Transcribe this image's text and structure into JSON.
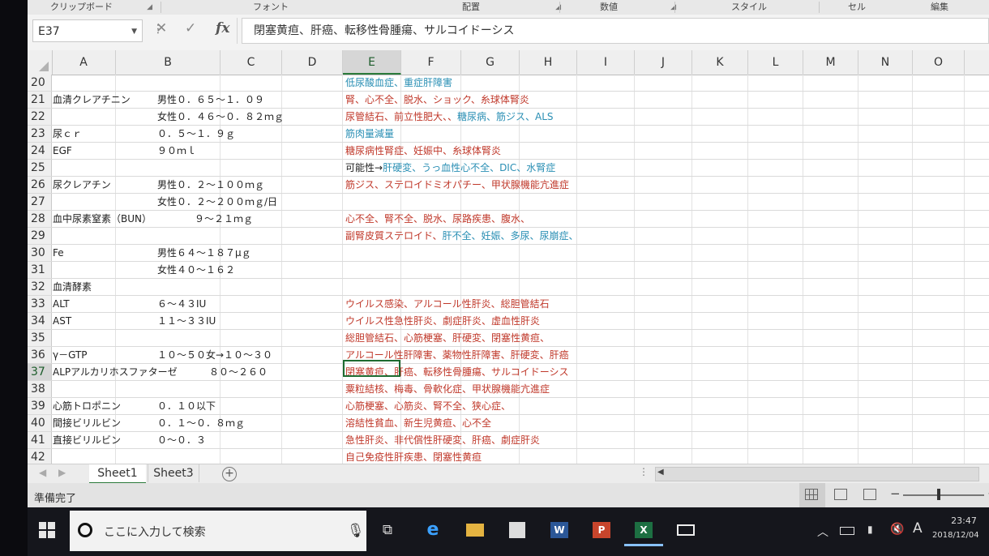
{
  "ribbon": {
    "groups": [
      "クリップボード",
      "フォント",
      "配置",
      "数値",
      "スタイル",
      "セル",
      "編集"
    ]
  },
  "formula_bar": {
    "name_box": "E37",
    "formula": "閉塞黄疸、肝癌、転移性骨腫瘍、サルコイドーシス"
  },
  "columns": [
    "A",
    "B",
    "C",
    "D",
    "E",
    "F",
    "G",
    "H",
    "I",
    "J",
    "K",
    "L",
    "M",
    "N",
    "O"
  ],
  "selected_cell": "E37",
  "rows": [
    {
      "num": "20",
      "a": "",
      "b": "",
      "e": "低尿酸血症、重症肝障害",
      "e_color": "teal"
    },
    {
      "num": "21",
      "a": "血清クレアチニン",
      "b": "男性０．６５～１．０９",
      "e": "腎、心不全、脱水、ショック、糸球体腎炎",
      "e_color": "red"
    },
    {
      "num": "22",
      "a": "",
      "b": "女性０．４６～０．８２ｍｇ",
      "e": "尿管結石、前立性肥大、、",
      "e2": "糖尿病、筋ジス、ALS",
      "e_color": "red",
      "e2_color": "teal"
    },
    {
      "num": "23",
      "a": "尿ｃｒ",
      "b": "０．５～１．９ｇ",
      "e": "筋肉量減量",
      "e_color": "teal"
    },
    {
      "num": "24",
      "a": "EGF",
      "b": "９０ｍｌ",
      "e": "糖尿病性腎症、妊娠中、糸球体腎炎",
      "e_color": "red"
    },
    {
      "num": "25",
      "a": "",
      "b": "",
      "e": "可能性→",
      "e2": "肝硬変、うっ血性心不全、DIC、水腎症",
      "e_color": "dark",
      "e2_color": "teal"
    },
    {
      "num": "26",
      "a": "尿クレアチン",
      "b": "男性０．２～１００ｍｇ",
      "e": "筋ジス、ステロイドミオパチー、甲状腺機能亢進症",
      "e_color": "red"
    },
    {
      "num": "27",
      "a": "",
      "b": "女性０．２～２００ｍｇ/日",
      "e": ""
    },
    {
      "num": "28",
      "a": "血中尿素窒素（BUN）",
      "b": "９～２１ｍｇ",
      "b_indent": true,
      "e": "心不全、腎不全、脱水、尿路疾患、腹水、",
      "e_color": "red"
    },
    {
      "num": "29",
      "a": "",
      "b": "",
      "e": "副腎皮質ステロイド、",
      "e2": "肝不全、妊娠、多尿、尿崩症、",
      "e_color": "red",
      "e2_color": "teal"
    },
    {
      "num": "30",
      "a": "Fe",
      "b": "男性６４～１８７μｇ",
      "e": ""
    },
    {
      "num": "31",
      "a": "",
      "b": "女性４０～１６２",
      "e": ""
    },
    {
      "num": "32",
      "a": "血清酵素",
      "b": "",
      "e": ""
    },
    {
      "num": "33",
      "a": "ALT",
      "b": "６～４３IU",
      "e": "ウイルス感染、アルコール性肝炎、総胆管結石",
      "e_color": "red"
    },
    {
      "num": "34",
      "a": "AST",
      "b": "１１～３３IU",
      "e": "ウイルス性急性肝炎、劇症肝炎、虚血性肝炎",
      "e_color": "red"
    },
    {
      "num": "35",
      "a": "",
      "b": "",
      "e": "総胆管結石、心筋梗塞、肝硬変、閉塞性黄疸、",
      "e_color": "red"
    },
    {
      "num": "36",
      "a": "γ－GTP",
      "b": "１０～５０女→１０～３０",
      "e": "アルコール性肝障害、薬物性肝障害、肝硬変、肝癌",
      "e_color": "red"
    },
    {
      "num": "37",
      "a": "ALPアルカリホスファターゼ",
      "b": "８０～２６０",
      "b_far": true,
      "e": "閉塞黄疸、肝癌、転移性骨腫瘍、サルコイドーシス",
      "e_color": "red"
    },
    {
      "num": "38",
      "a": "",
      "b": "",
      "e": "粟粒結核、梅毒、骨軟化症、甲状腺機能亢進症",
      "e_color": "red"
    },
    {
      "num": "39",
      "a": "心筋トロポニン",
      "b": "０．１０以下",
      "e": "心筋梗塞、心筋炎、腎不全、狭心症、",
      "e_color": "red"
    },
    {
      "num": "40",
      "a": "間接ビリルビン",
      "b": "０．１～０．８ｍｇ",
      "e": "溶結性貧血、新生児黄疸、心不全",
      "e_color": "red"
    },
    {
      "num": "41",
      "a": "直接ビリルビン",
      "b": "０～０．３",
      "e": "急性肝炎、非代償性肝硬変、肝癌、劇症肝炎",
      "e_color": "red"
    },
    {
      "num": "42",
      "a": "",
      "b": "",
      "e": "自己免疫性肝疾患、閉塞性黄疸",
      "e_color": "red"
    }
  ],
  "sheets": [
    "Sheet1",
    "Sheet3"
  ],
  "active_sheet": "Sheet1",
  "status": {
    "text": "準備完了"
  },
  "taskbar": {
    "search_placeholder": "ここに入力して検索",
    "time": "23:47",
    "date": "2018/12/04",
    "ime": "A"
  },
  "colors": {
    "red": "#c0392b",
    "teal": "#2a8fb4",
    "excel_green": "#1d6f42",
    "selection": "#1e6b30"
  }
}
